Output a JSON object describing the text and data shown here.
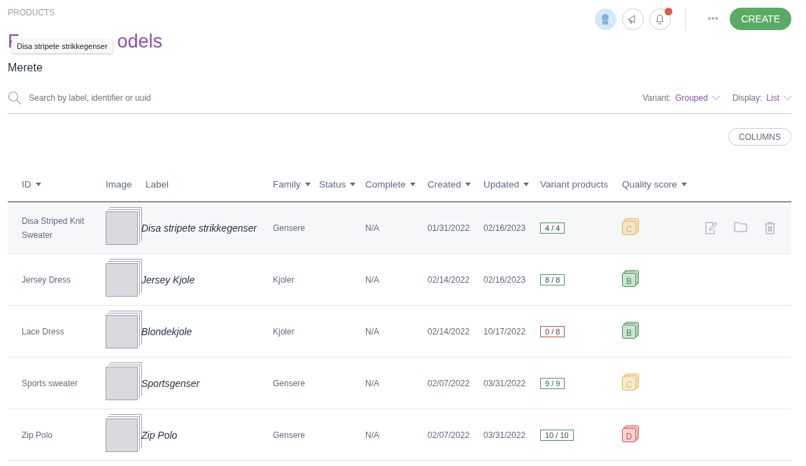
{
  "breadcrumb": "PRODUCTS",
  "title": {
    "start": "F",
    "end": "odels"
  },
  "tooltip": "Disa stripete strikkegenser",
  "subtitle": "Merete",
  "header_actions": {
    "notifications_unread": true,
    "more": "•••",
    "create": "CREATE"
  },
  "search": {
    "placeholder": "Search by label, identifier or uuid"
  },
  "filters": [
    {
      "label": "Variant:",
      "value": "Grouped"
    },
    {
      "label": "Display:",
      "value": "List"
    }
  ],
  "columns_button": "COLUMNS",
  "table": {
    "columns": [
      {
        "label": "ID",
        "sortable": true
      },
      {
        "label": "Image",
        "sortable": false
      },
      {
        "label": "Label",
        "sortable": false
      },
      {
        "label": "Family",
        "sortable": true
      },
      {
        "label": "Status",
        "sortable": true
      },
      {
        "label": "Complete",
        "sortable": true
      },
      {
        "label": "Created",
        "sortable": true
      },
      {
        "label": "Updated",
        "sortable": true
      },
      {
        "label": "Variant products",
        "sortable": false
      },
      {
        "label": "Quality score",
        "sortable": true
      }
    ],
    "rows": [
      {
        "id": "Disa Striped Knit Sweater",
        "label": "Disa stripete strikkegenser",
        "family": "Gensere",
        "complete": "N/A",
        "created": "01/31/2022",
        "updated": "02/16/2023",
        "variants": "4 / 4",
        "variants_complete": true,
        "grade": "C",
        "color": "#e8b04a",
        "selected": true
      },
      {
        "id": "Jersey Dress",
        "label": "Jersey Kjole",
        "family": "Kjoler",
        "complete": "N/A",
        "created": "02/14/2022",
        "updated": "02/16/2023",
        "variants": "8 / 8",
        "variants_complete": true,
        "grade": "B",
        "color": "#3f8f4e",
        "selected": false
      },
      {
        "id": "Lace Dress",
        "label": "Blondekjole",
        "family": "Kjoler",
        "complete": "N/A",
        "created": "02/14/2022",
        "updated": "10/17/2022",
        "variants": "0 / 8",
        "variants_complete": false,
        "grade": "B",
        "color": "#3f8f4e",
        "selected": false
      },
      {
        "id": "Sports sweater",
        "label": "Sportsgenser",
        "family": "Gensere",
        "complete": "N/A",
        "created": "02/07/2022",
        "updated": "03/31/2022",
        "variants": "9 / 9",
        "variants_complete": true,
        "grade": "C",
        "color": "#e8b04a",
        "selected": false
      },
      {
        "id": "Zip Polo",
        "label": "Zip Polo",
        "family": "Gensere",
        "complete": "N/A",
        "created": "02/07/2022",
        "updated": "03/31/2022",
        "variants": "10 / 10",
        "variants_complete": true,
        "grade": "D",
        "color": "#d9534f",
        "selected": false
      }
    ]
  }
}
